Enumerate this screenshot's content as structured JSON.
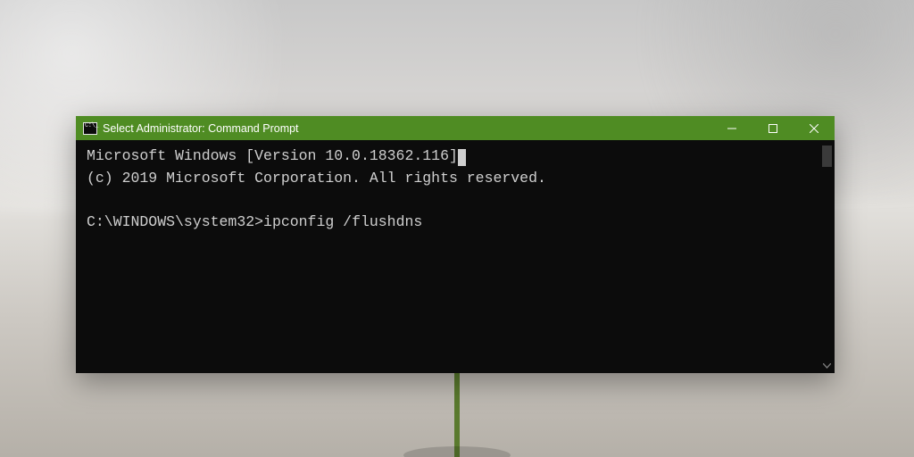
{
  "titlebar": {
    "title": "Select Administrator: Command Prompt"
  },
  "console": {
    "line1": "Microsoft Windows [Version 10.0.18362.116]",
    "line2": "(c) 2019 Microsoft Corporation. All rights reserved.",
    "blank": "",
    "prompt": "C:\\WINDOWS\\system32>",
    "command": "ipconfig /flushdns"
  }
}
